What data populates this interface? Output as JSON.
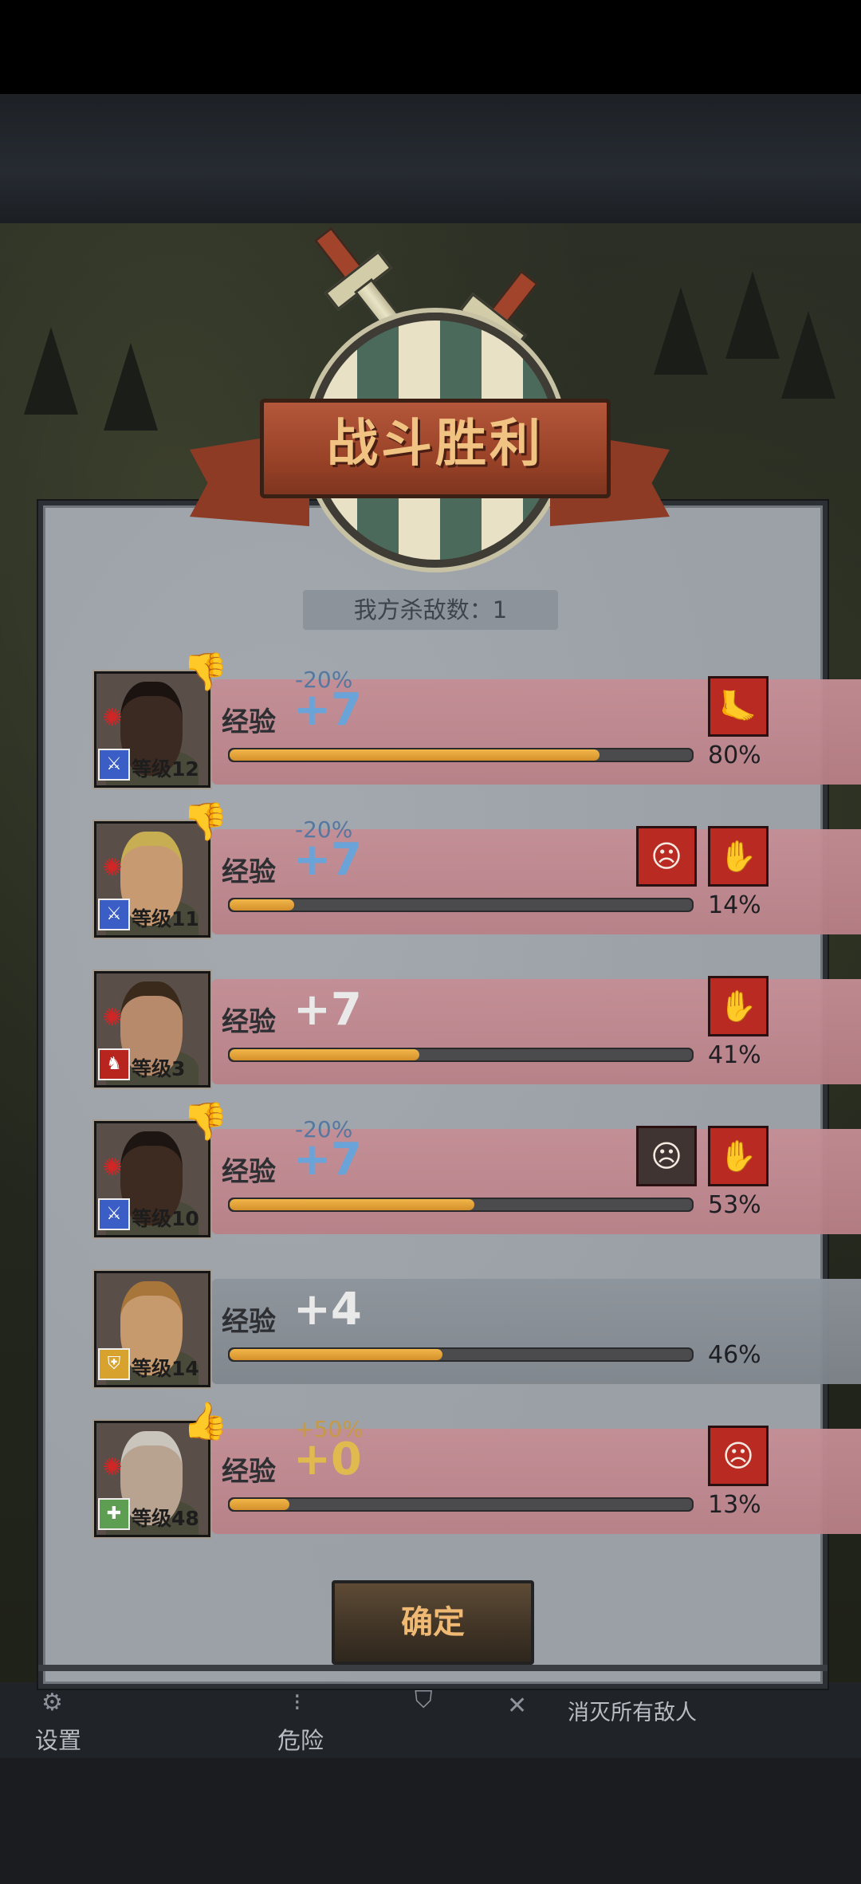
{
  "title": "战斗胜利",
  "kills_label": "我方杀敌数：1",
  "confirm_label": "确定",
  "exp_label": "经验",
  "rows": [
    {
      "level": "等级12",
      "modifier": "-20%",
      "gain": "+7",
      "progress": 0.8,
      "pct": "80%",
      "class": "sword",
      "thumb": "down"
    },
    {
      "level": "等级11",
      "modifier": "-20%",
      "gain": "+7",
      "progress": 0.14,
      "pct": "14%",
      "class": "sword",
      "thumb": "down"
    },
    {
      "level": "等级3",
      "modifier": "",
      "gain": "+7",
      "progress": 0.41,
      "pct": "41%",
      "class": "wolf",
      "thumb": ""
    },
    {
      "level": "等级10",
      "modifier": "-20%",
      "gain": "+7",
      "progress": 0.53,
      "pct": "53%",
      "class": "sword",
      "thumb": "down"
    },
    {
      "level": "等级14",
      "modifier": "",
      "gain": "+4",
      "progress": 0.46,
      "pct": "46%",
      "class": "shield",
      "thumb": ""
    },
    {
      "level": "等级48",
      "modifier": "+50%",
      "gain": "+0",
      "progress": 0.13,
      "pct": "13%",
      "class": "cross",
      "thumb": "up"
    }
  ],
  "footer": {
    "settings": "设置",
    "danger": "危险",
    "objective": "消灭所有敌人"
  }
}
